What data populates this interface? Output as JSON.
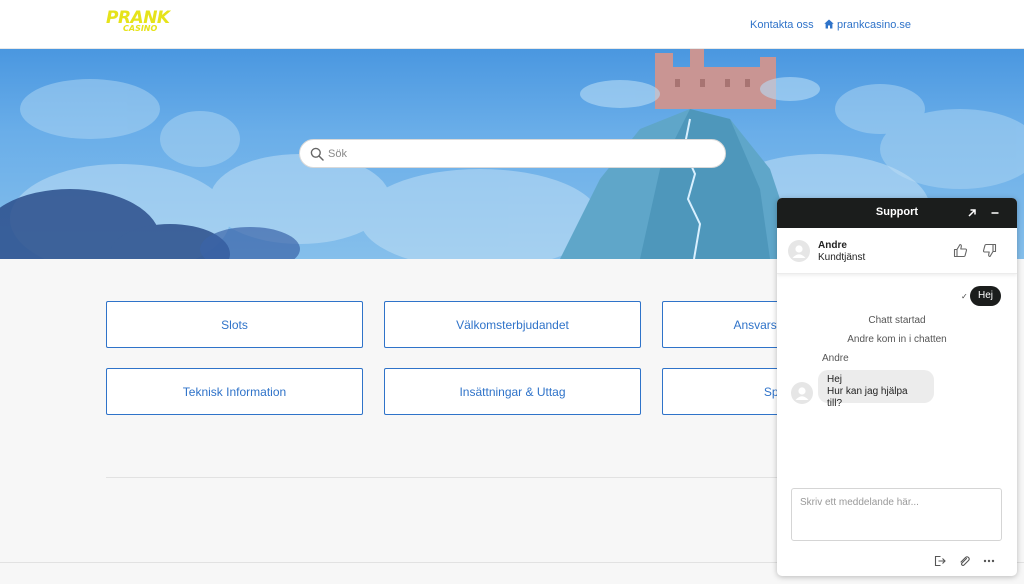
{
  "header": {
    "logo_top": "PRANK",
    "logo_bottom": "CASINO",
    "contact_label": "Kontakta oss",
    "site_label": "prankcasino.se"
  },
  "search": {
    "placeholder": "Sök"
  },
  "categories": [
    {
      "label": "Slots"
    },
    {
      "label": "Välkomsterbjudandet"
    },
    {
      "label": "Ansvarsfullt spelande"
    },
    {
      "label": "Teknisk Information"
    },
    {
      "label": "Insättningar & Uttag"
    },
    {
      "label": "Spelkonto"
    }
  ],
  "chat": {
    "title": "Support",
    "agent_name": "Andre",
    "agent_role": "Kundtjänst",
    "outgoing_message": "Hej",
    "system_messages": [
      "Chatt startad",
      "Andre kom in i chatten"
    ],
    "sender_name": "Andre",
    "incoming_lines": [
      "Hej",
      "Hur kan jag hjälpa till?"
    ],
    "input_placeholder": "Skriv ett meddelande här..."
  },
  "colors": {
    "brand_yellow": "#e6e31a",
    "link_blue": "#2f73c9",
    "chat_dark": "#1b1d1c"
  },
  "icons": [
    "home-icon",
    "search-icon",
    "expand-icon",
    "minimize-icon",
    "thumbs-up-icon",
    "thumbs-down-icon",
    "check-icon",
    "exit-icon",
    "paperclip-icon",
    "more-icon"
  ]
}
